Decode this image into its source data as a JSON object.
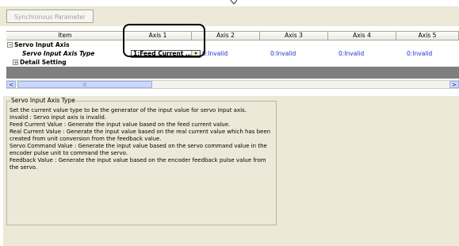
{
  "toolbar": {
    "sync_button_label": "Synchronous Parameter"
  },
  "grid": {
    "columns": [
      "Item",
      "Axis 1",
      "Axis 2",
      "Axis 3",
      "Axis 4",
      "Axis 5"
    ],
    "rows": [
      {
        "label": "Servo Input Axis",
        "expander": "−"
      },
      {
        "label": "Servo Input Axis Type",
        "axis1_value": "1:Feed Current ...",
        "values": [
          "0:Invalid",
          "0:Invalid",
          "0:Invalid",
          "0:Invalid"
        ]
      },
      {
        "label": "Detail Setting",
        "expander": "+"
      }
    ],
    "combo_arrow": "▾"
  },
  "scrollbar": {
    "left_arrow": "<",
    "right_arrow": ">",
    "thumb_grip": "|||"
  },
  "description": {
    "title": "Servo Input Axis Type",
    "lines": [
      "Set the current value type to be the generator of the input value for servo input axis.",
      "Invalid : Servo input axis is invalid.",
      "Feed Current Value : Generate the input value based on the feed current value.",
      "Real Current Value : Generate the input value based on the real current value which has been",
      "created from unit conversion from the feedback value.",
      "Servo Command Value : Generate the input value based on the servo command value in the",
      "encoder pulse unit to command the servo.",
      "Feedback Value : Generate the input value based on the encoder feedback pulse value from",
      "the servo."
    ]
  },
  "colors": {
    "panel": "#ece9d8",
    "value_blue": "#1d2fd0",
    "band_gray": "#7f7f7f",
    "border": "#aca899"
  }
}
